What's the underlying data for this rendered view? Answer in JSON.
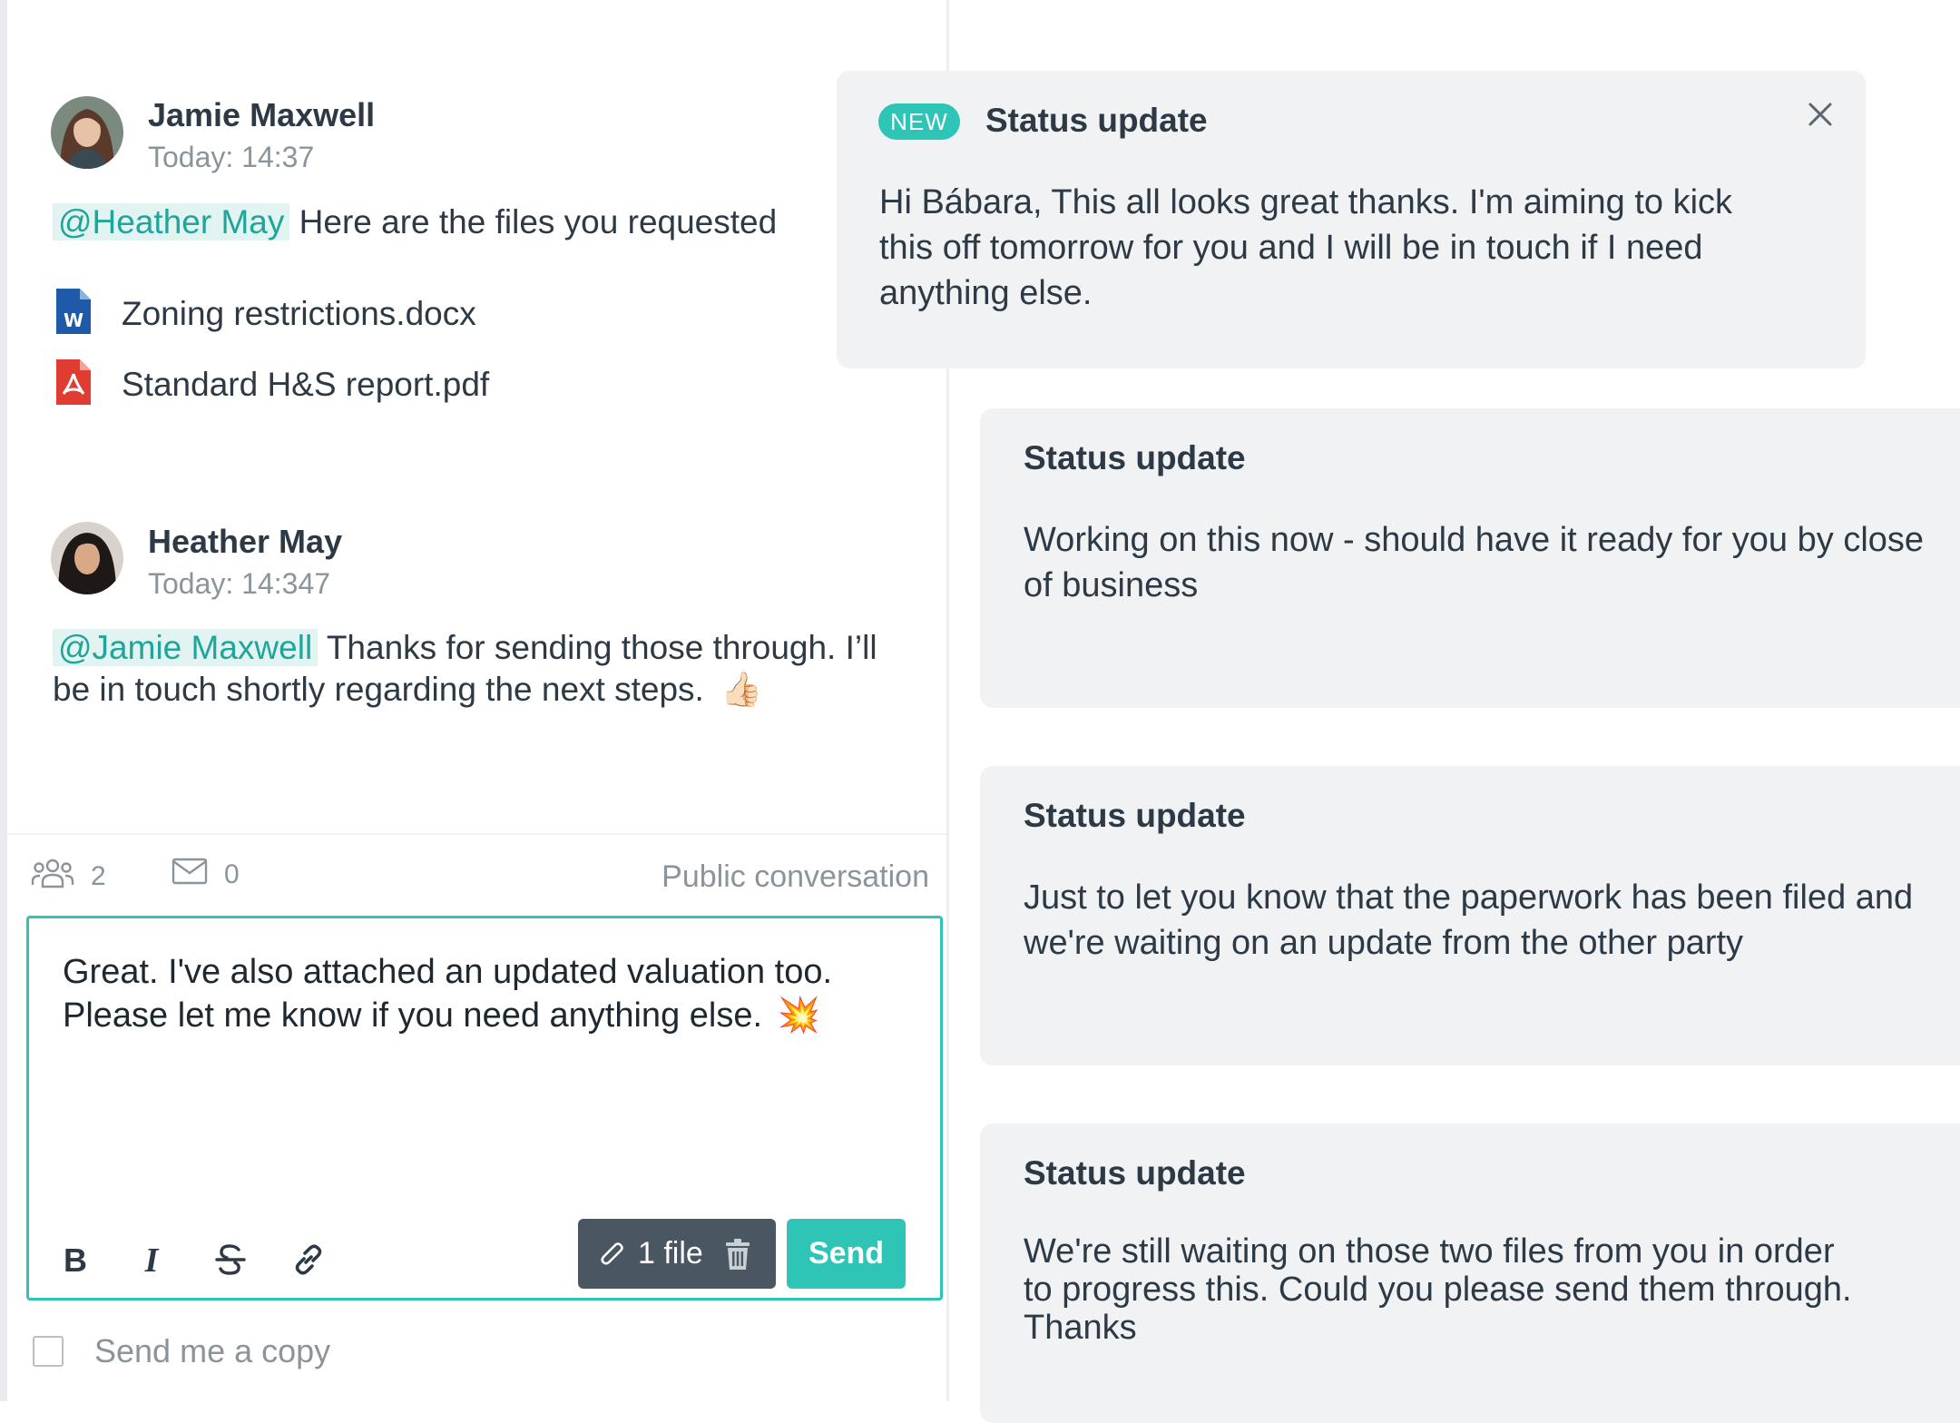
{
  "conversation": {
    "messages": [
      {
        "author": "Jamie Maxwell",
        "time": "Today: 14:37",
        "mention": "@Heather May",
        "text": "Here are the files you requested",
        "files": [
          {
            "name": "Zoning restrictions.docx",
            "icon": "word-document-icon"
          },
          {
            "name": "Standard H&S report.pdf",
            "icon": "pdf-document-icon"
          }
        ]
      },
      {
        "author": "Heather May",
        "time": "Today: 14:347",
        "mention": "@Jamie Maxwell",
        "text_line1": "Thanks for sending those through. I’ll",
        "text_line2": "be in touch shortly regarding the next steps.",
        "emoji": "👍🏻"
      }
    ]
  },
  "composer": {
    "participants_count": "2",
    "messages_count": "0",
    "visibility": "Public conversation",
    "draft_line1": "Great. I've also attached an updated valuation too.",
    "draft_line2": "Please let me know if you need anything else.",
    "draft_emoji": "💥",
    "attachment_label": "1 file",
    "send_label": "Send",
    "copy_label": "Send me a copy",
    "copy_checked": false
  },
  "status_updates": [
    {
      "badge": "NEW",
      "title": "Status update",
      "body": "Hi Bábara, This all looks great thanks. I'm aiming to kick this off tomorrow for you and I will be in touch if I need anything else."
    },
    {
      "title": "Status update",
      "body": "Working on this now - should have it ready for you by close of business"
    },
    {
      "title": "Status update",
      "body": "Just to let you know that the paperwork has been filed and we're waiting on an update from the other party"
    },
    {
      "title": "Status update",
      "body": "We're still waiting on those two files from you in order to progress this. Could you please send them through. Thanks"
    }
  ],
  "colors": {
    "accent": "#2ec4b6",
    "mention_bg": "#e2f4f2",
    "card_bg": "#f0f2f4",
    "text": "#2d3a45",
    "muted": "#8a949c"
  }
}
